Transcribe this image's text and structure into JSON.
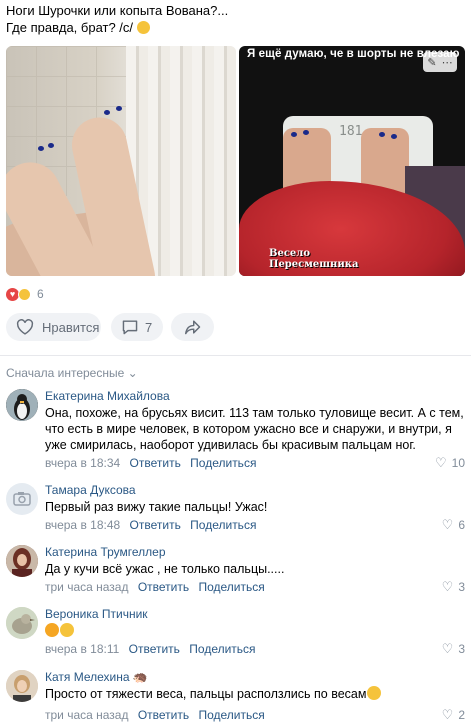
{
  "post": {
    "line1": "Ноги Шурочки или копыта Вована?...",
    "line2": "Где правда, брат? /с/"
  },
  "photos": {
    "caption": "Я ещё думаю, че в шорты не влезаю",
    "scale_display": "181",
    "watermark_line1": "Весело",
    "watermark_line2": "Пересмешника"
  },
  "reactions": {
    "count": "6"
  },
  "actions": {
    "like_label": "Нравится",
    "comments_count": "7"
  },
  "comments_sort": "Сначала интересные",
  "comments": [
    {
      "name": "Екатерина Михайлова",
      "text": "Она, похоже, на брусьях висит. 113 там только туловище весит. А с тем, что есть в мире человек, в котором ужасно все и снаружи, и внутри, я уже смирилась, наоборот удивилась бы красивым пальцам ног.",
      "time": "вчера в 18:34",
      "reply": "Ответить",
      "share": "Поделиться",
      "likes": "10"
    },
    {
      "name": "Тамара Дуксова",
      "text": "Первый раз вижу такие пальцы! Ужас!",
      "time": "вчера в 18:48",
      "reply": "Ответить",
      "share": "Поделиться",
      "likes": "6"
    },
    {
      "name": "Катерина Трумгеллер",
      "text": "Да у кучи всё ужас , не только пальцы.....",
      "time": "три часа назад",
      "reply": "Ответить",
      "share": "Поделиться",
      "likes": "3"
    },
    {
      "name": "Вероника Птичник",
      "text": "",
      "time": "вчера в 18:11",
      "reply": "Ответить",
      "share": "Поделиться",
      "likes": "3"
    },
    {
      "name": "Катя Мелехина",
      "text": "Просто от тяжести веса, пальцы расползлись по весам",
      "time": "три часа назад",
      "reply": "Ответить",
      "share": "Поделиться",
      "likes": "2"
    }
  ],
  "colors": {
    "link": "#2a5885",
    "muted": "#818c99",
    "button_bg": "#f0f2f5"
  }
}
